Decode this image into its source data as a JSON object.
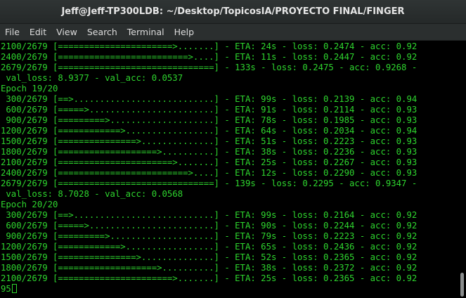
{
  "window": {
    "title": "Jeff@Jeff-TP300LDB: ~/Desktop/TopicosIA/PROYECTO FINAL/FINGER"
  },
  "menu": [
    "File",
    "Edit",
    "View",
    "Search",
    "Terminal",
    "Help"
  ],
  "terminal": {
    "lines": [
      "2100/2679 [======================>.......] - ETA: 24s - loss: 0.2474 - acc: 0.92",
      "2400/2679 [=========================>....] - ETA: 11s - loss: 0.2447 - acc: 0.92",
      "2679/2679 [==============================] - 133s - loss: 0.2475 - acc: 0.9268 - ",
      " val_loss: 8.9377 - val_acc: 0.0537",
      "Epoch 19/20",
      " 300/2679 [==>...........................] - ETA: 99s - loss: 0.2139 - acc: 0.94",
      " 600/2679 [=====>........................] - ETA: 91s - loss: 0.2114 - acc: 0.93",
      " 900/2679 [=========>....................] - ETA: 78s - loss: 0.1985 - acc: 0.93",
      "1200/2679 [============>.................] - ETA: 64s - loss: 0.2034 - acc: 0.94",
      "1500/2679 [===============>..............] - ETA: 51s - loss: 0.2223 - acc: 0.93",
      "1800/2679 [===================>..........] - ETA: 38s - loss: 0.2236 - acc: 0.93",
      "2100/2679 [======================>.......] - ETA: 25s - loss: 0.2267 - acc: 0.93",
      "2400/2679 [=========================>....] - ETA: 12s - loss: 0.2290 - acc: 0.93",
      "2679/2679 [==============================] - 139s - loss: 0.2295 - acc: 0.9347 - ",
      " val_loss: 8.7028 - val_acc: 0.0568",
      "Epoch 20/20",
      " 300/2679 [==>...........................] - ETA: 99s - loss: 0.2164 - acc: 0.92",
      " 600/2679 [=====>........................] - ETA: 90s - loss: 0.2244 - acc: 0.92",
      " 900/2679 [=========>....................] - ETA: 79s - loss: 0.2223 - acc: 0.92",
      "1200/2679 [============>.................] - ETA: 65s - loss: 0.2436 - acc: 0.92",
      "1500/2679 [===============>..............] - ETA: 52s - loss: 0.2365 - acc: 0.92",
      "1800/2679 [===================>..........] - ETA: 38s - loss: 0.2372 - acc: 0.92",
      "2100/2679 [======================>.......] - ETA: 25s - loss: 0.2365 - acc: 0.92",
      "95"
    ],
    "text_color": "#2ed52e",
    "background_color": "#000000"
  }
}
